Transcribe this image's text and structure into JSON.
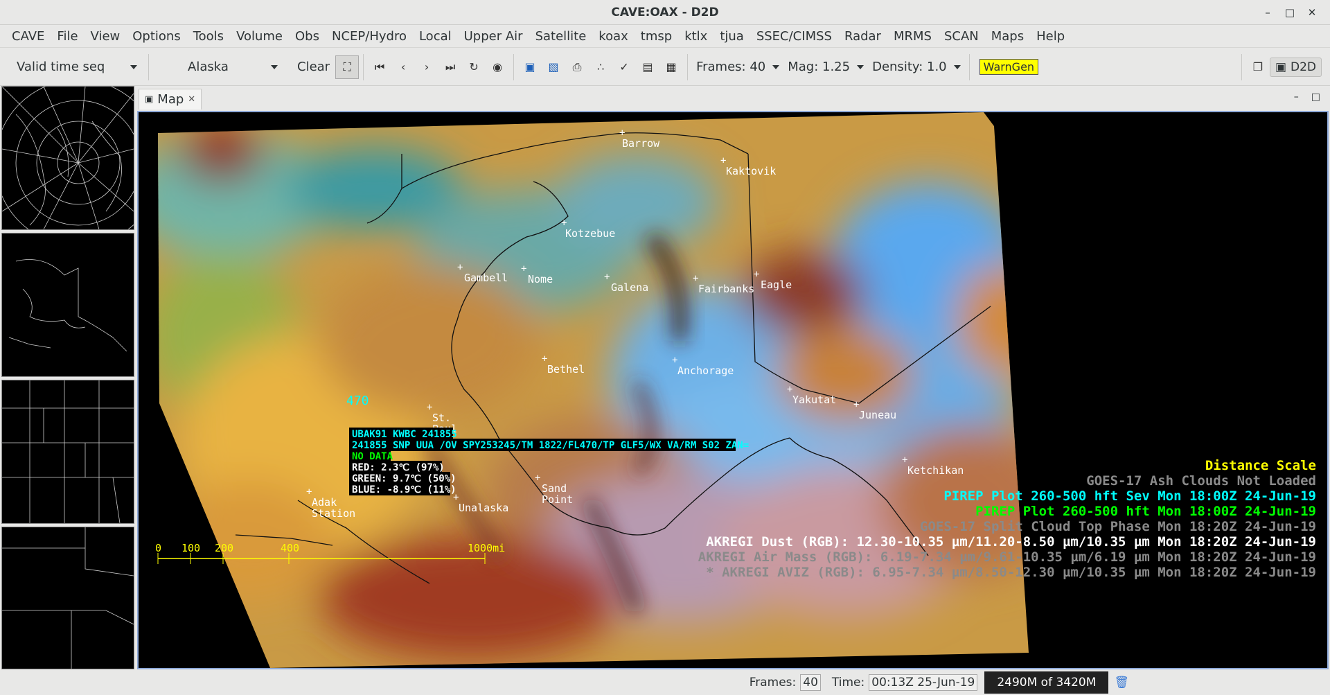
{
  "window": {
    "title": "CAVE:OAX - D2D"
  },
  "menu": [
    "CAVE",
    "File",
    "View",
    "Options",
    "Tools",
    "Volume",
    "Obs",
    "NCEP/Hydro",
    "Local",
    "Upper Air",
    "Satellite",
    "koax",
    "tmsp",
    "ktlx",
    "tjua",
    "SSEC/CIMSS",
    "Radar",
    "MRMS",
    "SCAN",
    "Maps",
    "Help"
  ],
  "toolbar": {
    "time_seq": "Valid time seq",
    "area": "Alaska",
    "clear": "Clear",
    "frames": "Frames: 40",
    "mag": "Mag: 1.25",
    "density": "Density: 1.0",
    "warngen": "WarnGen",
    "perspective": "D2D"
  },
  "map_tab": {
    "label": "Map"
  },
  "cities": [
    {
      "name": "Barrow"
    },
    {
      "name": "Kaktovik"
    },
    {
      "name": "Kotzebue"
    },
    {
      "name": "Gambell"
    },
    {
      "name": "Nome"
    },
    {
      "name": "Galena"
    },
    {
      "name": "Fairbanks"
    },
    {
      "name": "Eagle"
    },
    {
      "name": "Bethel"
    },
    {
      "name": "Anchorage"
    },
    {
      "name": "Yakutat"
    },
    {
      "name": "Juneau"
    },
    {
      "name": "St."
    },
    {
      "name": "Paul"
    },
    {
      "name": "Ketchikan"
    },
    {
      "name": "Sand"
    },
    {
      "name": "Point"
    },
    {
      "name": "Unalaska"
    },
    {
      "name": "Adak"
    },
    {
      "name": "Station"
    }
  ],
  "pirep_marker": "470",
  "sample_readout": {
    "header": "UBAK91 KWBC 241855",
    "report": "241855 SNP UUA /OV SPY253245/TM 1822/FL470/TP GLF5/WX VA/RM S02 ZAN=",
    "nodata": "NO DATA",
    "red": "RED: 2.3℃ (97%)",
    "green": "GREEN: 9.7℃ (50%)",
    "blue": "BLUE: -8.9℃ (11%)"
  },
  "legend": [
    {
      "text": "Distance Scale",
      "color": "#ffff00"
    },
    {
      "text": "GOES-17 Ash Clouds Not Loaded",
      "color": "#8a8a8a"
    },
    {
      "text": "PIREP Plot 260-500 hft Sev Mon 18:00Z 24-Jun-19",
      "color": "#00ffff"
    },
    {
      "text": "PIREP Plot 260-500 hft Mon 18:00Z 24-Jun-19",
      "color": "#00ff00"
    },
    {
      "text": "GOES-17 Split Cloud Top Phase Mon 18:20Z 24-Jun-19",
      "color": "#8a8a8a"
    },
    {
      "text": "AKREGI Dust (RGB): 12.30-10.35 µm/11.20-8.50 µm/10.35 µm Mon 18:20Z 24-Jun-19",
      "color": "#ffffff"
    },
    {
      "text": "AKREGI Air Mass (RGB): 6.19-7.34 µm/9.61-10.35 µm/6.19 µm Mon 18:20Z 24-Jun-19",
      "color": "#8a8a8a"
    },
    {
      "text": "* AKREGI AVIZ (RGB): 6.95-7.34 µm/8.50-12.30 µm/10.35 µm Mon 18:20Z 24-Jun-19",
      "color": "#8a8a8a"
    }
  ],
  "scale": {
    "ticks": [
      "0",
      "100",
      "200",
      "400",
      "1000mi"
    ]
  },
  "status": {
    "frames_label": "Frames:",
    "frames_value": "40",
    "time_label": "Time:",
    "time_value": "00:13Z 25-Jun-19",
    "memory": "2490M of 3420M"
  }
}
